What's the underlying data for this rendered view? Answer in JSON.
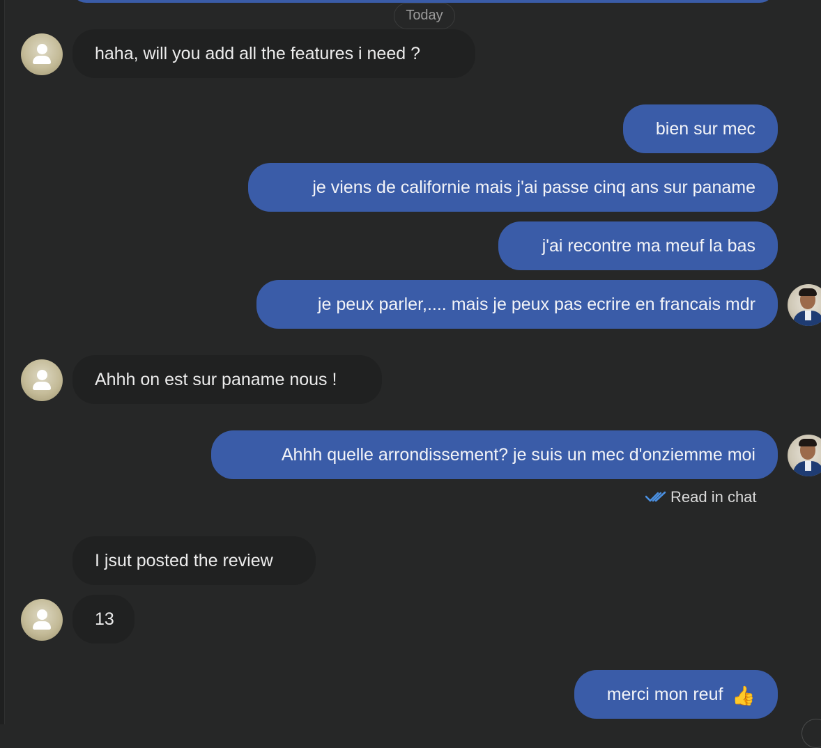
{
  "date_separator": "Today",
  "messages": [
    {
      "text": "haha, will you add all the features i need ?"
    },
    {
      "text": "bien sur mec"
    },
    {
      "text": "je viens de californie mais j'ai passe cinq ans sur paname"
    },
    {
      "text": "j'ai recontre ma meuf la bas"
    },
    {
      "text": "je peux parler,.... mais je peux pas ecrire en francais mdr"
    },
    {
      "text": "Ahhh on est sur paname nous !"
    },
    {
      "text": "Ahhh quelle arrondissement? je suis un mec d'onziemme moi"
    },
    {
      "text": "I jsut posted the review"
    },
    {
      "text": "13"
    },
    {
      "text": "merci mon reuf",
      "emoji": "👍"
    }
  ],
  "read_receipt": {
    "label": "Read in chat",
    "icon": "double-check-icon"
  },
  "colors": {
    "background": "#262727",
    "incoming_bubble": "#202121",
    "outgoing_bubble": "#3a5ca8",
    "read_check": "#4a8fe0"
  }
}
